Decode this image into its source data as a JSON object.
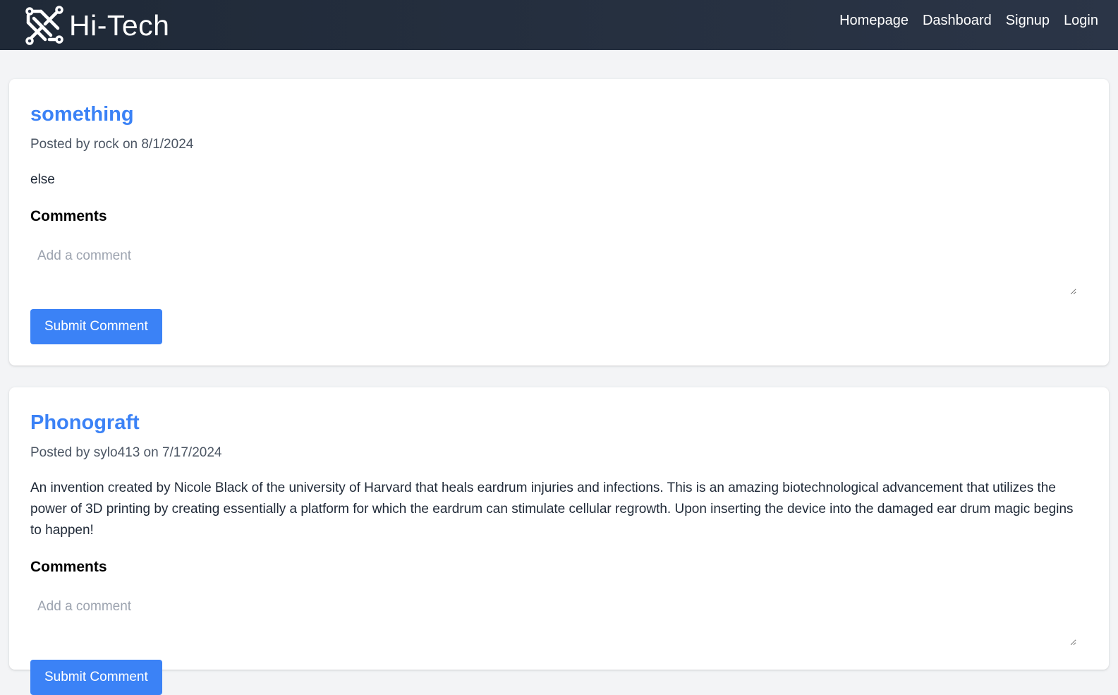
{
  "header": {
    "brand_name": "Hi-Tech",
    "logo_icon": "circuit-logo-icon",
    "nav": [
      {
        "label": "Homepage"
      },
      {
        "label": "Dashboard"
      },
      {
        "label": "Signup"
      },
      {
        "label": "Login"
      }
    ]
  },
  "posts": [
    {
      "title": "something",
      "meta": "Posted by rock on 8/1/2024",
      "body": "else",
      "comments_heading": "Comments",
      "comment_placeholder": "Add a comment",
      "submit_label": "Submit Comment"
    },
    {
      "title": "Phonograft",
      "meta": "Posted by sylo413 on 7/17/2024",
      "body": "An invention created by Nicole Black of the university of Harvard that heals eardrum injuries and infections. This is an amazing biotechnological advancement that utilizes the power of 3D printing by creating essentially a platform for which the eardrum can stimulate cellular regrowth. Upon inserting the device into the damaged ear drum magic begins to happen!",
      "comments_heading": "Comments",
      "comment_placeholder": "Add a comment",
      "submit_label": "Submit Comment"
    }
  ],
  "colors": {
    "nav_bg": "#1f2937",
    "accent": "#3b82f6",
    "page_bg": "#f3f4f6"
  }
}
